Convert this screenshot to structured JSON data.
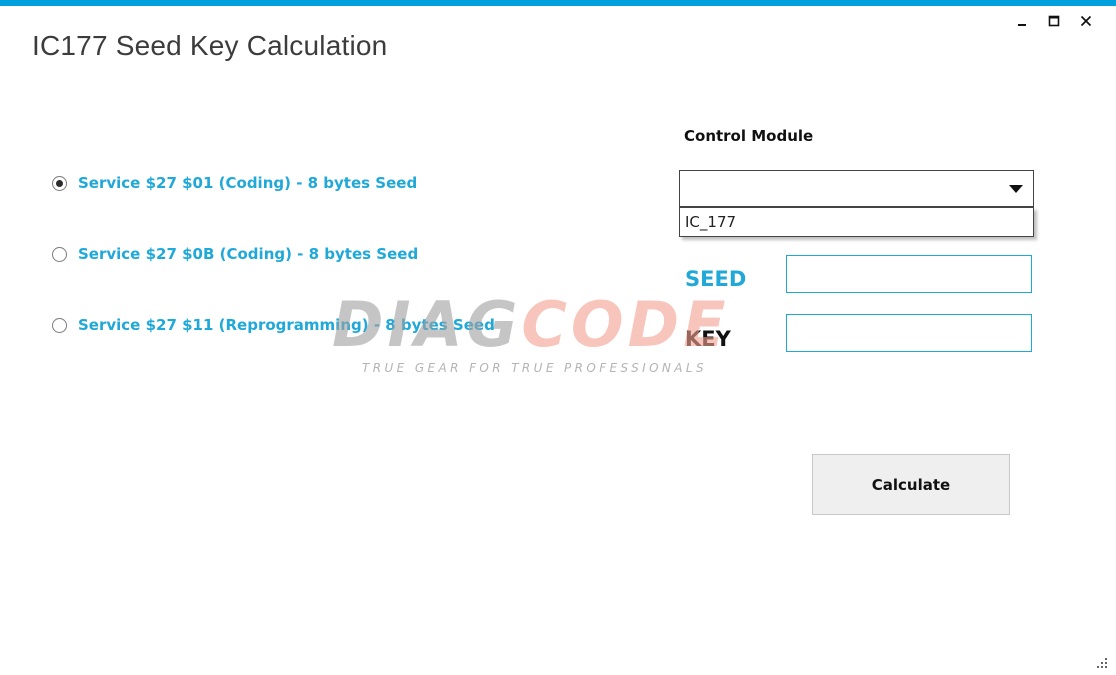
{
  "window": {
    "title": "IC177 Seed Key Calculation",
    "accent_color": "#00a0dc",
    "controls": {
      "minimize_icon": "minimize-icon",
      "maximize_icon": "maximize-icon",
      "close_icon": "close-icon"
    }
  },
  "services": {
    "selected_index": 0,
    "options": [
      {
        "label": "Service $27 $01 (Coding) - 8 bytes Seed",
        "selected": true
      },
      {
        "label": "Service $27 $0B (Coding) - 8 bytes Seed",
        "selected": false
      },
      {
        "label": "Service $27 $11 (Reprogramming) - 8 bytes Seed",
        "selected": false
      }
    ],
    "label_color": "#1fa8d8"
  },
  "control_module": {
    "label": "Control Module",
    "selected_value": "",
    "dropdown_open": true,
    "options": [
      "IC_177"
    ]
  },
  "seed": {
    "label": "SEED",
    "value": "",
    "label_color": "#1fa8d8"
  },
  "key": {
    "label": "KEY",
    "value": ""
  },
  "calculate_button": {
    "label": "Calculate"
  },
  "watermark": {
    "part1": "DIAG",
    "part2": "CODE",
    "tagline": "TRUE GEAR FOR TRUE PROFESSIONALS"
  }
}
